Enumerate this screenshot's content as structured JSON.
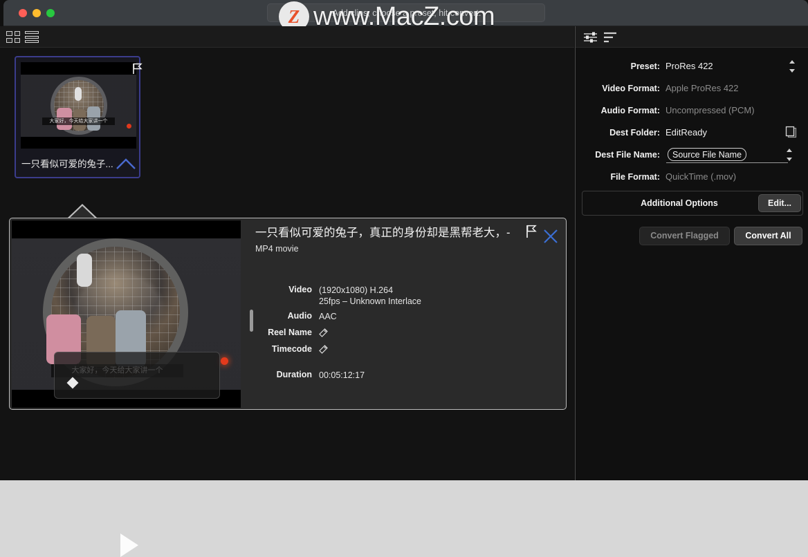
{
  "window": {
    "title_field_text": "Add clips, choose a preset, hit convert.",
    "watermark_badge": "Z",
    "watermark_text": "www.MacZ.com",
    "traffic_lights": [
      "close-red",
      "minimize-yellow",
      "zoom-green"
    ]
  },
  "toolbar": {
    "grid_view_icon": "grid-view-icon",
    "list_view_icon": "list-view-icon"
  },
  "clip_card": {
    "title": "一只看似可爱的兔子...",
    "caption": "大家好，今天给大家讲一个",
    "flag_icon": "flag-icon",
    "chevron_icon": "chevron-up-icon",
    "selected_border_color": "#3b3c8c"
  },
  "detail": {
    "title": "一只看似可爱的兔子，真正的身份却是黑帮老大，-",
    "subtitle": "MP4 movie",
    "preview_caption": "大家好，今天给大家讲一个",
    "play_icon": "play-icon",
    "flag_icon": "flag-icon",
    "close_icon": "close-icon",
    "close_color": "#3b6fd4",
    "rows": [
      {
        "label": "Video",
        "value": "(1920x1080) H.264",
        "value2": "25fps – Unknown Interlace"
      },
      {
        "label": "Audio",
        "value": "AAC"
      },
      {
        "label": "Reel Name",
        "icon": "tag-icon",
        "value": ""
      },
      {
        "label": "Timecode",
        "icon": "tag-icon",
        "value": ""
      }
    ],
    "duration_label": "Duration",
    "duration_value": "00:05:12:17"
  },
  "right_panel": {
    "settings_icon": "sliders-icon",
    "sort_icon": "sort-list-icon",
    "fields": [
      {
        "label": "Preset:",
        "value": "ProRes 422",
        "style": "bright",
        "control": "stepper"
      },
      {
        "label": "Video Format:",
        "value": "Apple ProRes 422",
        "style": "dim"
      },
      {
        "label": "Audio Format:",
        "value": "Uncompressed (PCM)",
        "style": "dim"
      },
      {
        "label": "Dest Folder:",
        "value": "EditReady",
        "style": "bright",
        "control": "folder-icon"
      },
      {
        "label": "Dest File Name:",
        "value": "Source File Name",
        "style": "token",
        "control": "stepper"
      },
      {
        "label": "File Format:",
        "value": "QuickTime (.mov)",
        "style": "dim"
      }
    ],
    "additional_options_label": "Additional Options",
    "edit_button": "Edit...",
    "convert_flagged_button": "Convert Flagged",
    "convert_all_button": "Convert All"
  }
}
